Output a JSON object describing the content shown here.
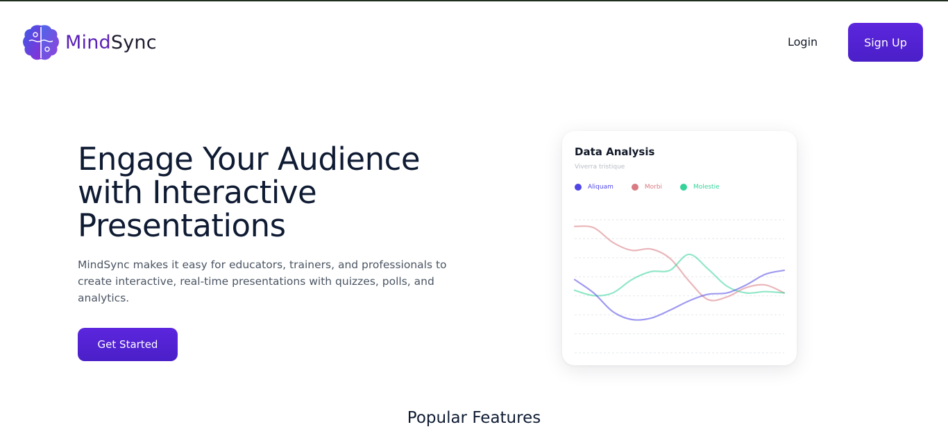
{
  "header": {
    "brand_part1": "Mind",
    "brand_part2": "Sync",
    "login_label": "Login",
    "signup_label": "Sign Up"
  },
  "hero": {
    "title": "Engage Your Audience with Interactive Presentations",
    "description": "MindSync makes it easy for educators, trainers, and professionals to create interactive, real-time presentations with quizzes, polls, and analytics.",
    "cta_label": "Get Started"
  },
  "card": {
    "title": "Data Analysis",
    "subtitle": "Viverra tristique"
  },
  "chart_data": {
    "type": "line",
    "title": "Data Analysis",
    "subtitle": "Viverra tristique",
    "legend_position": "top-left",
    "grid": true,
    "series": [
      {
        "name": "Aliquam",
        "color": "#4f46e5",
        "values": [
          55,
          45,
          31,
          25,
          26,
          32,
          39,
          44,
          45,
          51,
          59,
          62
        ]
      },
      {
        "name": "Morbi",
        "color": "#d97a82",
        "values": [
          95,
          94,
          83,
          77,
          78,
          71,
          54,
          40,
          42,
          49,
          51,
          45
        ]
      },
      {
        "name": "Molestie",
        "color": "#34d399",
        "values": [
          47,
          43,
          45,
          55,
          61,
          62,
          74,
          63,
          50,
          45,
          46,
          45
        ]
      }
    ],
    "ylim": [
      0,
      100
    ]
  },
  "features": {
    "heading": "Popular Features"
  },
  "colors": {
    "primary": "#5b21b6",
    "button": "#5225d8",
    "text_dark": "#0f1b33"
  }
}
